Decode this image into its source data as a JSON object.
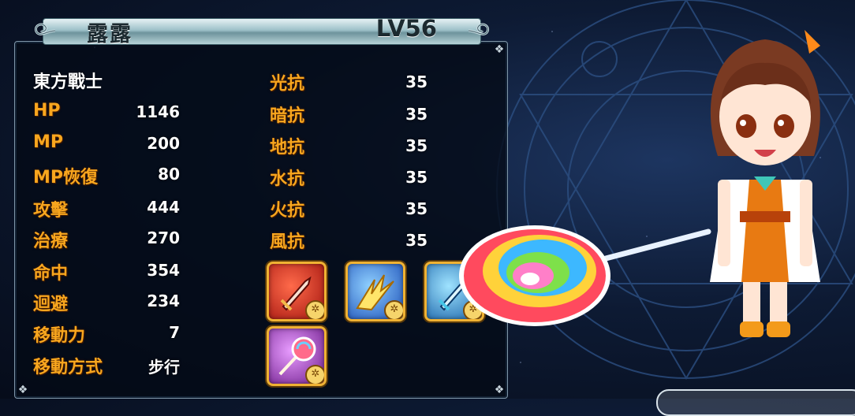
{
  "character": {
    "name": "露露",
    "level": "LV56",
    "class_name": "東方戰士"
  },
  "stats": [
    {
      "label": "HP",
      "value": "1146"
    },
    {
      "label": "MP",
      "value": "200"
    },
    {
      "label": "MP恢復",
      "value": "80"
    },
    {
      "label": "攻擊",
      "value": "444"
    },
    {
      "label": "治療",
      "value": "270"
    },
    {
      "label": "命中",
      "value": "354"
    },
    {
      "label": "迴避",
      "value": "234"
    },
    {
      "label": "移動力",
      "value": "7"
    },
    {
      "label": "移動方式",
      "value": "步行"
    }
  ],
  "resistances": [
    {
      "label": "光抗",
      "value": "35"
    },
    {
      "label": "暗抗",
      "value": "35"
    },
    {
      "label": "地抗",
      "value": "35"
    },
    {
      "label": "水抗",
      "value": "35"
    },
    {
      "label": "火抗",
      "value": "35"
    },
    {
      "label": "風抗",
      "value": "35"
    }
  ],
  "skills": [
    {
      "icon": "sword-skill-icon",
      "color": "#c0241b"
    },
    {
      "icon": "burst-skill-icon",
      "color": "#2f6fd6"
    },
    {
      "icon": "blue-sword-skill-icon",
      "color": "#1d7fc4"
    },
    {
      "icon": "lollipop-skill-icon",
      "color": "#8a2fa8"
    }
  ],
  "colors": {
    "label": "#f8a61e",
    "value": "#ffffff",
    "skill_border": "#f0b233"
  }
}
